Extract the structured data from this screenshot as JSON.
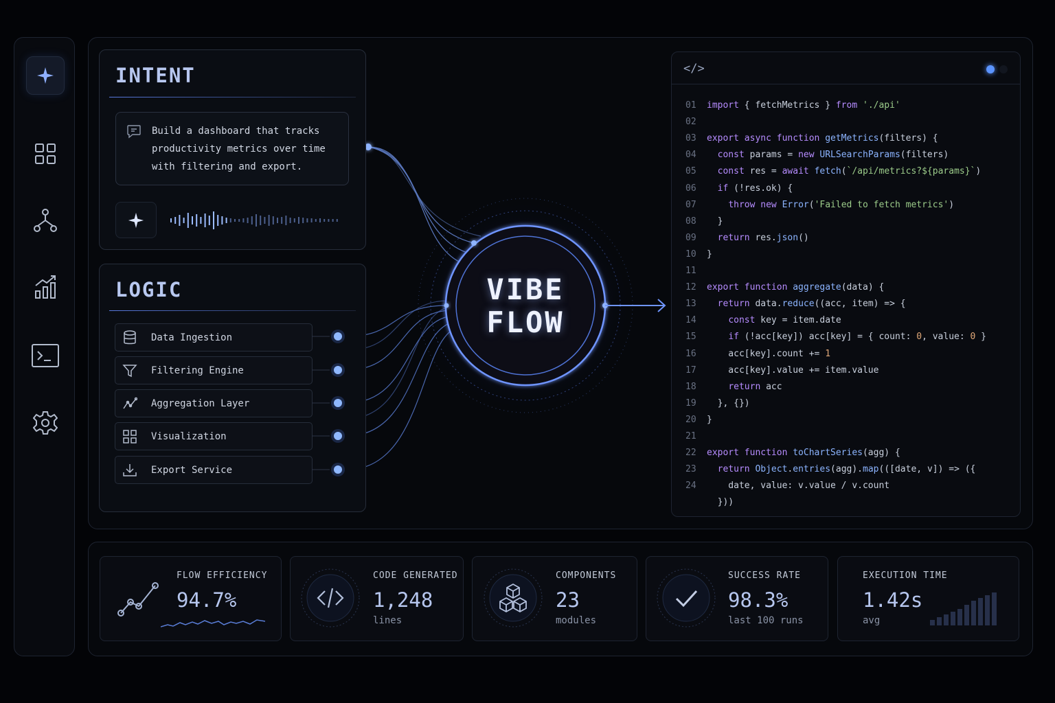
{
  "sidebar": {
    "items": [
      {
        "icon": "sparkle-icon",
        "active": true
      },
      {
        "icon": "grid-icon"
      },
      {
        "icon": "hierarchy-icon"
      },
      {
        "icon": "bar-chart-icon"
      },
      {
        "icon": "terminal-icon"
      },
      {
        "icon": "gear-icon"
      }
    ]
  },
  "intent": {
    "title": "INTENT",
    "prompt_lines": [
      "Build a dashboard that tracks",
      "productivity metrics over time",
      "with filtering and export."
    ]
  },
  "logic": {
    "title": "LOGIC",
    "items": [
      {
        "label": "Data Ingestion",
        "icon": "database-icon"
      },
      {
        "label": "Filtering Engine",
        "icon": "filter-icon"
      },
      {
        "label": "Aggregation Layer",
        "icon": "line-chart-icon"
      },
      {
        "label": "Visualization",
        "icon": "grid-icon"
      },
      {
        "label": "Export Service",
        "icon": "download-icon"
      }
    ]
  },
  "core": {
    "line1": "VIBE",
    "line2": "FLOW"
  },
  "code": {
    "header_icon": "</>",
    "lines": [
      {
        "n": "01",
        "h": "<span class='kw'>import</span> { fetchMetrics } <span class='kw'>from</span> <span class='st'>'./api'</span>"
      },
      {
        "n": "02",
        "h": ""
      },
      {
        "n": "03",
        "h": "<span class='kw'>export async function</span> <span class='fn'>getMetrics</span>(filters) {"
      },
      {
        "n": "04",
        "h": "  <span class='kw'>const</span> params = <span class='kw'>new</span> <span class='fn'>URLSearchParams</span>(filters)"
      },
      {
        "n": "05",
        "h": "  <span class='kw'>const</span> res = <span class='kw'>await</span> <span class='fn'>fetch</span>(<span class='st'>`/api/metrics?${params}`</span>)"
      },
      {
        "n": "06",
        "h": "  <span class='kw'>if</span> (!res.ok) {"
      },
      {
        "n": "07",
        "h": "    <span class='kw'>throw new</span> <span class='fn'>Error</span>(<span class='st'>'Failed to fetch metrics'</span>)"
      },
      {
        "n": "08",
        "h": "  }"
      },
      {
        "n": "09",
        "h": "  <span class='kw'>return</span> res.<span class='fn'>json</span>()"
      },
      {
        "n": "10",
        "h": "}"
      },
      {
        "n": "11",
        "h": ""
      },
      {
        "n": "12",
        "h": "<span class='kw'>export function</span> <span class='fn'>aggregate</span>(data) {"
      },
      {
        "n": "13",
        "h": "  <span class='kw'>return</span> data.<span class='fn'>reduce</span>((acc, item) => {"
      },
      {
        "n": "14",
        "h": "    <span class='kw'>const</span> key = item.date"
      },
      {
        "n": "15",
        "h": "    <span class='kw'>if</span> (!acc[key]) acc[key] = { count: <span class='nm'>0</span>, value: <span class='nm'>0</span> }"
      },
      {
        "n": "16",
        "h": "    acc[key].count += <span class='nm'>1</span>"
      },
      {
        "n": "17",
        "h": "    acc[key].value += item.value"
      },
      {
        "n": "18",
        "h": "    <span class='kw'>return</span> acc"
      },
      {
        "n": "19",
        "h": "  }, {})"
      },
      {
        "n": "20",
        "h": "}"
      },
      {
        "n": "21",
        "h": ""
      },
      {
        "n": "22",
        "h": "<span class='kw'>export function</span> <span class='fn'>toChartSeries</span>(agg) {"
      },
      {
        "n": "23",
        "h": "  <span class='kw'>return</span> <span class='fn'>Object</span>.<span class='fn'>entries</span>(agg).<span class='fn'>map</span>(([date, v]) => ({"
      },
      {
        "n": "24",
        "h": "    date, value: v.value / v.count"
      },
      {
        "n": "",
        "h": "  }))"
      }
    ]
  },
  "stats": [
    {
      "label": "FLOW EFFICIENCY",
      "value": "94.7%",
      "sub": "",
      "icon": "trend-line-icon"
    },
    {
      "label": "CODE GENERATED",
      "value": "1,248",
      "sub": "lines",
      "icon": "code-icon"
    },
    {
      "label": "COMPONENTS",
      "value": "23",
      "sub": "modules",
      "icon": "cubes-icon"
    },
    {
      "label": "SUCCESS RATE",
      "value": "98.3%",
      "sub": "last 100 runs",
      "icon": "check-icon"
    },
    {
      "label": "EXECUTION TIME",
      "value": "1.42s",
      "sub": "avg",
      "icon": "bars-icon"
    }
  ]
}
